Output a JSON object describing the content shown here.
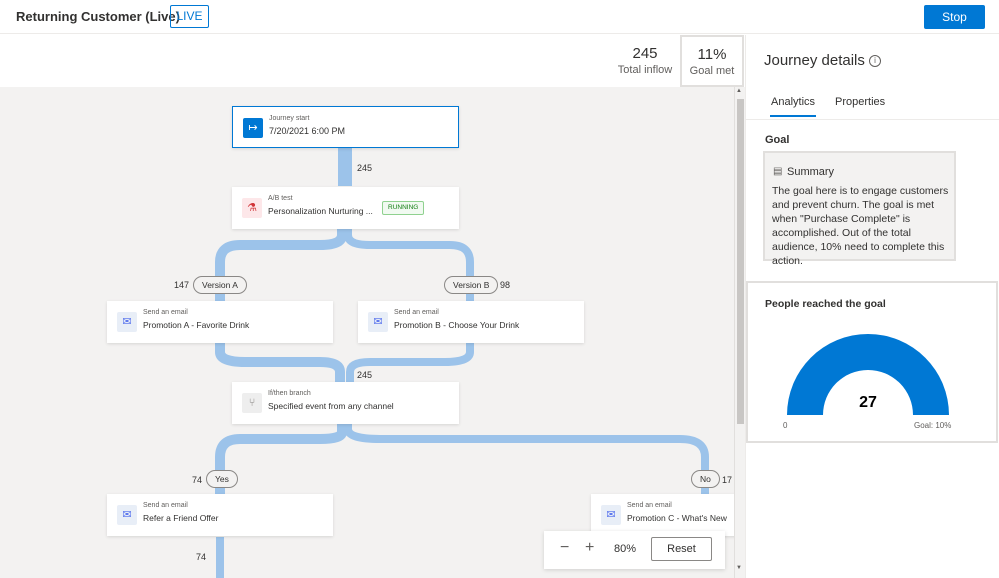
{
  "header": {
    "title": "Returning Customer (Live)",
    "status_badge": "LIVE",
    "stop_label": "Stop"
  },
  "metrics": {
    "total_inflow": {
      "value": "245",
      "label": "Total inflow"
    },
    "goal_met": {
      "value": "11%",
      "label": "Goal met"
    }
  },
  "canvas": {
    "nodes": {
      "start": {
        "kind": "Journey start",
        "name": "7/20/2021 6:00 PM",
        "icon": "arrow-right-icon"
      },
      "ab_test": {
        "kind": "A/B test",
        "name": "Personalization Nurturing ...",
        "status": "RUNNING",
        "icon": "flask-icon"
      },
      "email_a": {
        "kind": "Send an email",
        "name": "Promotion A - Favorite Drink",
        "icon": "mail-icon"
      },
      "email_b": {
        "kind": "Send an email",
        "name": "Promotion B - Choose Your Drink",
        "icon": "mail-icon"
      },
      "branch": {
        "kind": "If/then branch",
        "name": "Specified event from any channel",
        "icon": "branch-icon"
      },
      "email_referral": {
        "kind": "Send an email",
        "name": "Refer a Friend Offer",
        "icon": "mail-icon"
      },
      "email_c": {
        "kind": "Send an email",
        "name": "Promotion C - What's New",
        "icon": "mail-icon"
      }
    },
    "branch_labels": {
      "version_a": "Version A",
      "version_b": "Version B",
      "yes": "Yes",
      "no": "No"
    },
    "counts": {
      "after_start": "245",
      "version_a": "147",
      "version_b": "98",
      "merged": "245",
      "yes": "74",
      "no": "17",
      "after_referral": "74"
    },
    "flow_color": "#9cc3ea"
  },
  "zoom": {
    "minus": "−",
    "plus": "+",
    "level": "80%",
    "reset_label": "Reset"
  },
  "panel": {
    "title": "Journey details",
    "tabs": [
      {
        "label": "Analytics",
        "active": true
      },
      {
        "label": "Properties",
        "active": false
      }
    ],
    "goal_heading": "Goal",
    "summary_label": "Summary",
    "summary_text": "The goal here is to engage customers and prevent churn. The goal is met when \"Purchase Complete\" is accomplished. Out of the total audience, 10% need to complete this action.",
    "goal_card_title": "People reached the goal",
    "gauge": {
      "value": "27",
      "min_label": "0",
      "max_label": "Goal: 10%",
      "fill_color": "#0078d4"
    }
  }
}
